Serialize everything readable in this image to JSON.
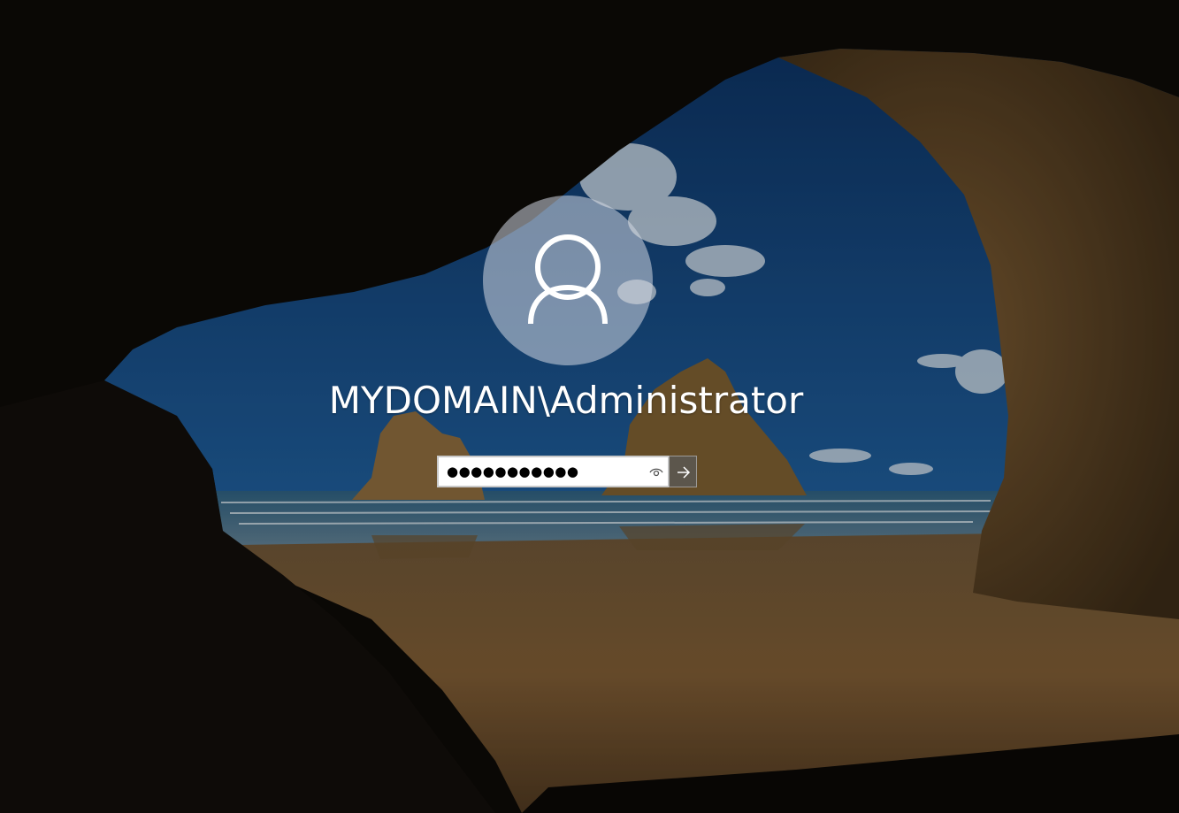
{
  "login": {
    "username": "MYDOMAIN\\Administrator",
    "password_mask": "●●●●●●●●●●●",
    "reveal_icon": "eye-icon",
    "submit_icon": "arrow-right-icon",
    "avatar_icon": "user-icon"
  },
  "colors": {
    "sky": "#1b4f86",
    "sand": "#7a5a35",
    "rock": "#1a140e",
    "text": "#ffffff",
    "field_bg": "#ffffff",
    "submit_bg": "#5a5a5a"
  }
}
